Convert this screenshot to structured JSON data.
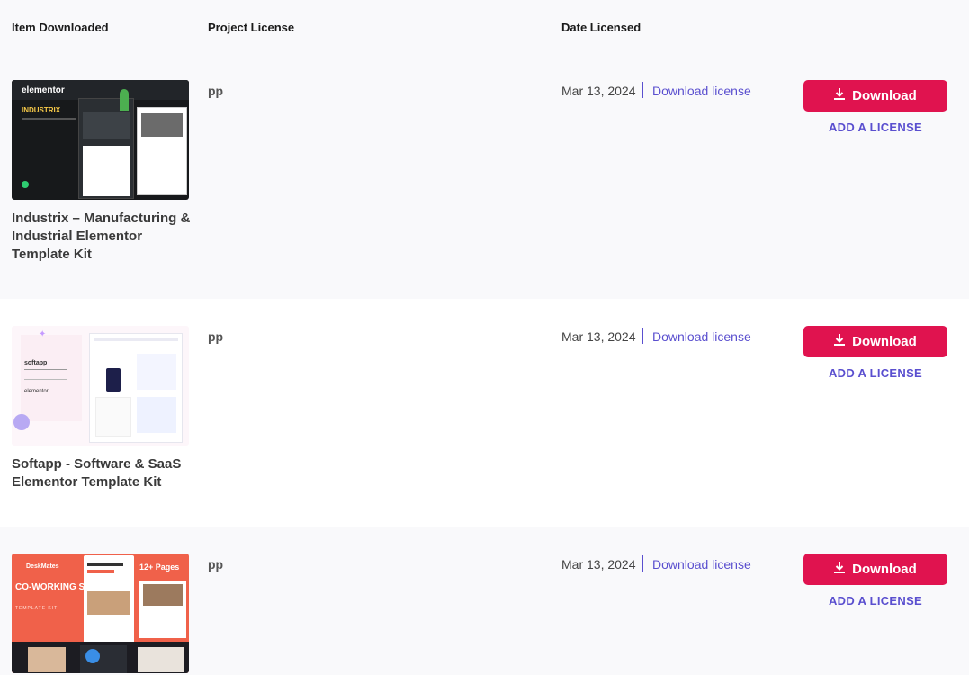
{
  "table": {
    "headers": {
      "item": "Item Downloaded",
      "license": "Project License",
      "date": "Date Licensed"
    },
    "rows": [
      {
        "title": "Industrix – Manufacturing & Industrial Elementor Template Kit",
        "thumb_brand": "elementor",
        "thumb_name": "INDUSTRIX",
        "license": "pp",
        "date": "Mar 13, 2024",
        "download_license": "Download license",
        "download_button": "Download",
        "add_license": "ADD A LICENSE"
      },
      {
        "title": "Softapp - Software & SaaS Elementor Template Kit",
        "thumb_brand": "elementor",
        "thumb_name": "softapp",
        "license": "pp",
        "date": "Mar 13, 2024",
        "download_license": "Download license",
        "download_button": "Download",
        "add_license": "ADD A LICENSE"
      },
      {
        "title": "",
        "thumb_brand": "DeskMates",
        "thumb_name": "CO-WORKING SPACE",
        "thumb_kit": "TEMPLATE KIT",
        "thumb_badge": "12+ Pages",
        "license": "pp",
        "date": "Mar 13, 2024",
        "download_license": "Download license",
        "download_button": "Download",
        "add_license": "ADD A LICENSE"
      }
    ]
  },
  "colors": {
    "accent_red": "#e0134f",
    "link_purple": "#5a4fcf",
    "row_alt_bg": "#f9f9fb"
  },
  "icons": {
    "download": "download-icon"
  }
}
